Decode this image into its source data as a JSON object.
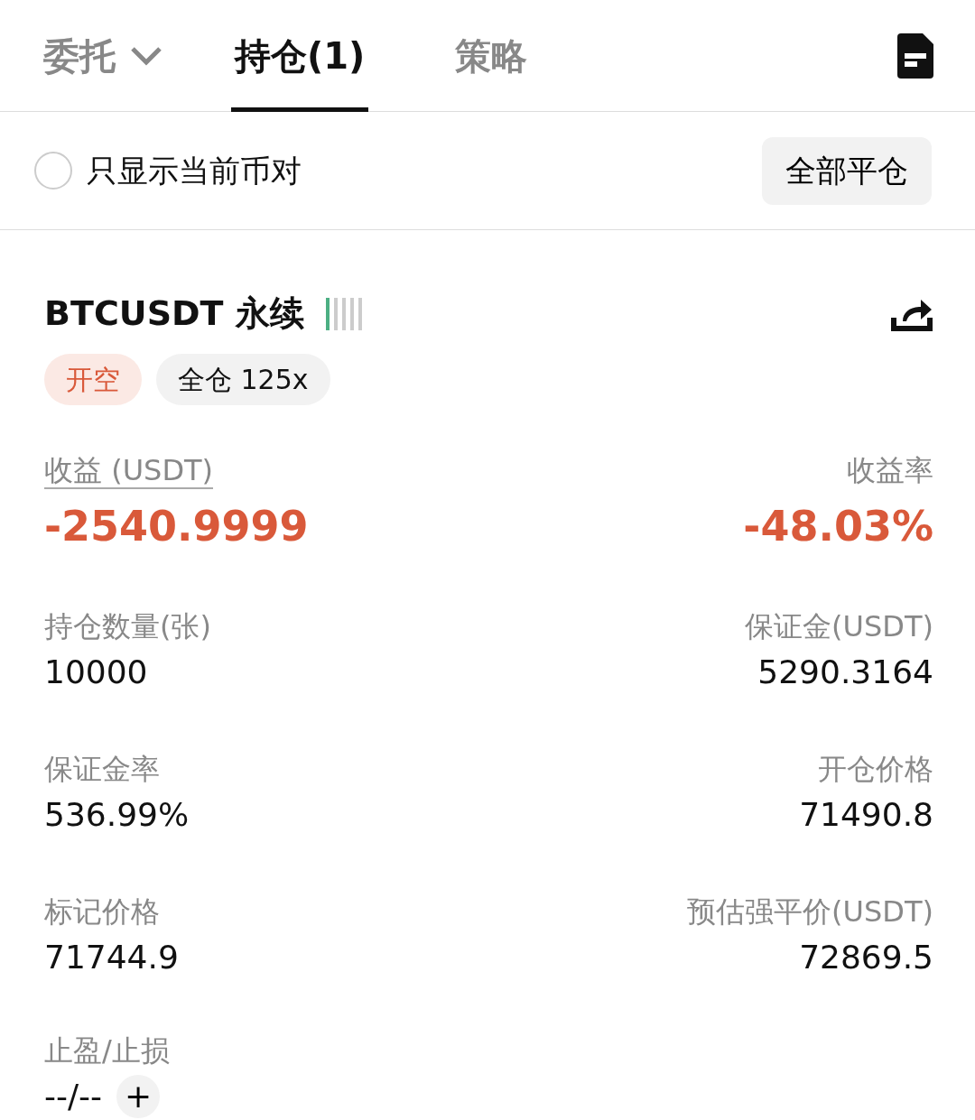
{
  "tabs": [
    {
      "label": "委托",
      "dropdown": true,
      "selected": false
    },
    {
      "label": "持仓(1)",
      "dropdown": false,
      "selected": true
    },
    {
      "label": "策略",
      "dropdown": false,
      "selected": false
    }
  ],
  "filter": {
    "label": "只显示当前币对",
    "checked": false
  },
  "close_all_button": "全部平仓",
  "position": {
    "symbol": "BTCUSDT 永续",
    "risk": {
      "level": 0.2
    },
    "tags": [
      {
        "label": "开空",
        "kind": "side"
      },
      {
        "label": "全仓 125x",
        "kind": "margin"
      }
    ],
    "pnl": {
      "label": "收益 (USDT)",
      "value": "-2540.9999"
    },
    "roi": {
      "label": "收益率",
      "value": "-48.03%"
    },
    "fields": [
      {
        "label": "持仓数量(张)",
        "value": "10000"
      },
      {
        "label": "保证金(USDT)",
        "value": "5290.3164"
      },
      {
        "label": "保证金率",
        "value": "536.99%"
      },
      {
        "label": "开仓价格",
        "value": "71490.8"
      },
      {
        "label": "标记价格",
        "value": "71744.9"
      },
      {
        "label": "预估强平价(USDT)",
        "value": "72869.5"
      }
    ],
    "tpsl": {
      "label": "止盈/止损",
      "value": "--/--",
      "add": "+"
    }
  }
}
